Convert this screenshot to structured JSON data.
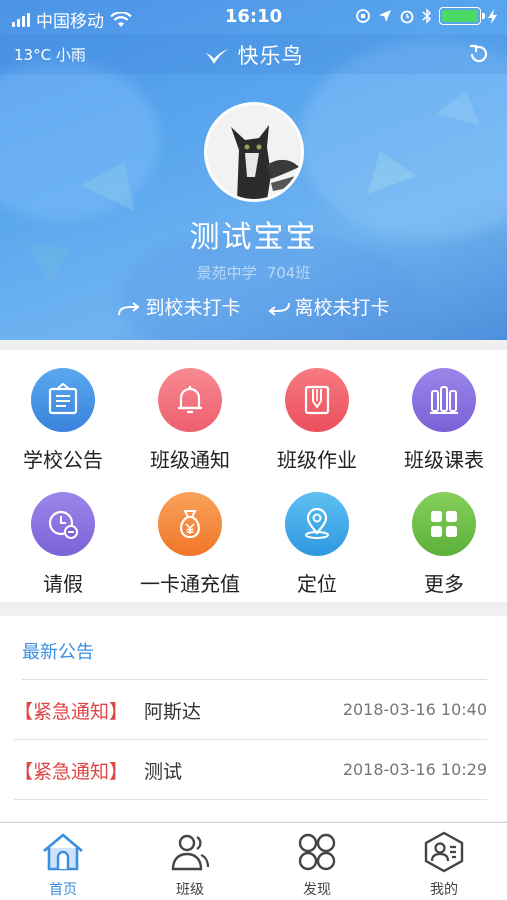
{
  "status_bar": {
    "carrier": "中国移动",
    "time": "16:10"
  },
  "header": {
    "weather": "13°C 小雨",
    "app_title": "快乐鸟"
  },
  "profile": {
    "child_name": "测试宝宝",
    "school": "景苑中学",
    "class": "704班",
    "arrive_status": "到校未打卡",
    "leave_status": "离校未打卡"
  },
  "menu": [
    {
      "label": "学校公告",
      "color": "#4a95e6",
      "icon": "bulletin-board-icon"
    },
    {
      "label": "班级通知",
      "color": "#f06b78",
      "icon": "bell-icon"
    },
    {
      "label": "班级作业",
      "color": "#f0606a",
      "icon": "pencil-book-icon"
    },
    {
      "label": "班级课表",
      "color": "#8a74e0",
      "icon": "schedule-icon"
    },
    {
      "label": "请假",
      "color": "#8b74e0",
      "icon": "clock-minus-icon"
    },
    {
      "label": "一卡通充值",
      "color": "#f5893a",
      "icon": "money-bag-icon"
    },
    {
      "label": "定位",
      "color": "#3aa9e8",
      "icon": "location-pin-icon"
    },
    {
      "label": "更多",
      "color": "#6cc04a",
      "icon": "grid-more-icon"
    }
  ],
  "announcements": {
    "heading": "最新公告",
    "items": [
      {
        "tag": "【紧急通知】",
        "title": "阿斯达",
        "time": "2018-03-16 10:40"
      },
      {
        "tag": "【紧急通知】",
        "title": "测试",
        "time": "2018-03-16 10:29"
      }
    ]
  },
  "tabs": [
    {
      "label": "首页",
      "icon": "home-icon",
      "active": true
    },
    {
      "label": "班级",
      "icon": "class-people-icon",
      "active": false
    },
    {
      "label": "发现",
      "icon": "discover-icon",
      "active": false
    },
    {
      "label": "我的",
      "icon": "profile-icon",
      "active": false
    }
  ],
  "colors": {
    "accent": "#3a8fe0",
    "urgent_tag": "#e04545",
    "battery": "#4cd964"
  }
}
